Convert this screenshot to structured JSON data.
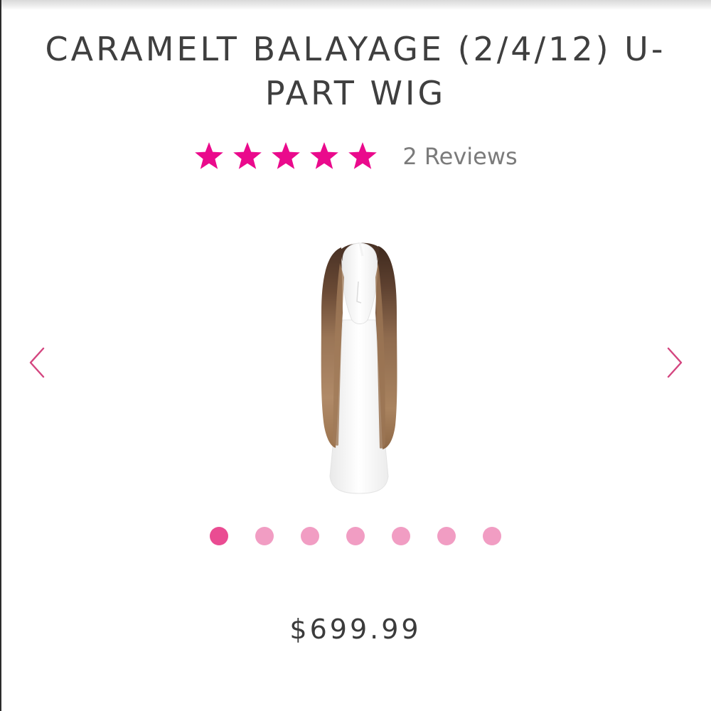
{
  "product": {
    "title": "CARAMELT BALAYAGE (2/4/12) U-PART WIG",
    "title_line1": "CARAMELT BALAYAGE (2/4/12) U-",
    "title_line2": "PART WIG",
    "price": "$699.99",
    "image": {
      "alt": "wig on mannequin head",
      "icon": "wig-mannequin-image"
    }
  },
  "rating": {
    "stars_filled": 5,
    "stars_total": 5,
    "reviews_label": "2 Reviews",
    "star_color": "#ea0a8c"
  },
  "carousel": {
    "prev_icon": "chevron-left-icon",
    "next_icon": "chevron-right-icon",
    "arrow_color": "#d4457f",
    "slide_count": 7,
    "active_index": 0,
    "dot_active_color": "#ea4c92",
    "dot_inactive_color": "#f19dc3"
  },
  "colors": {
    "title": "#3f3f3f",
    "reviews_text": "#7b7b7b",
    "price": "#3b3b3b"
  }
}
